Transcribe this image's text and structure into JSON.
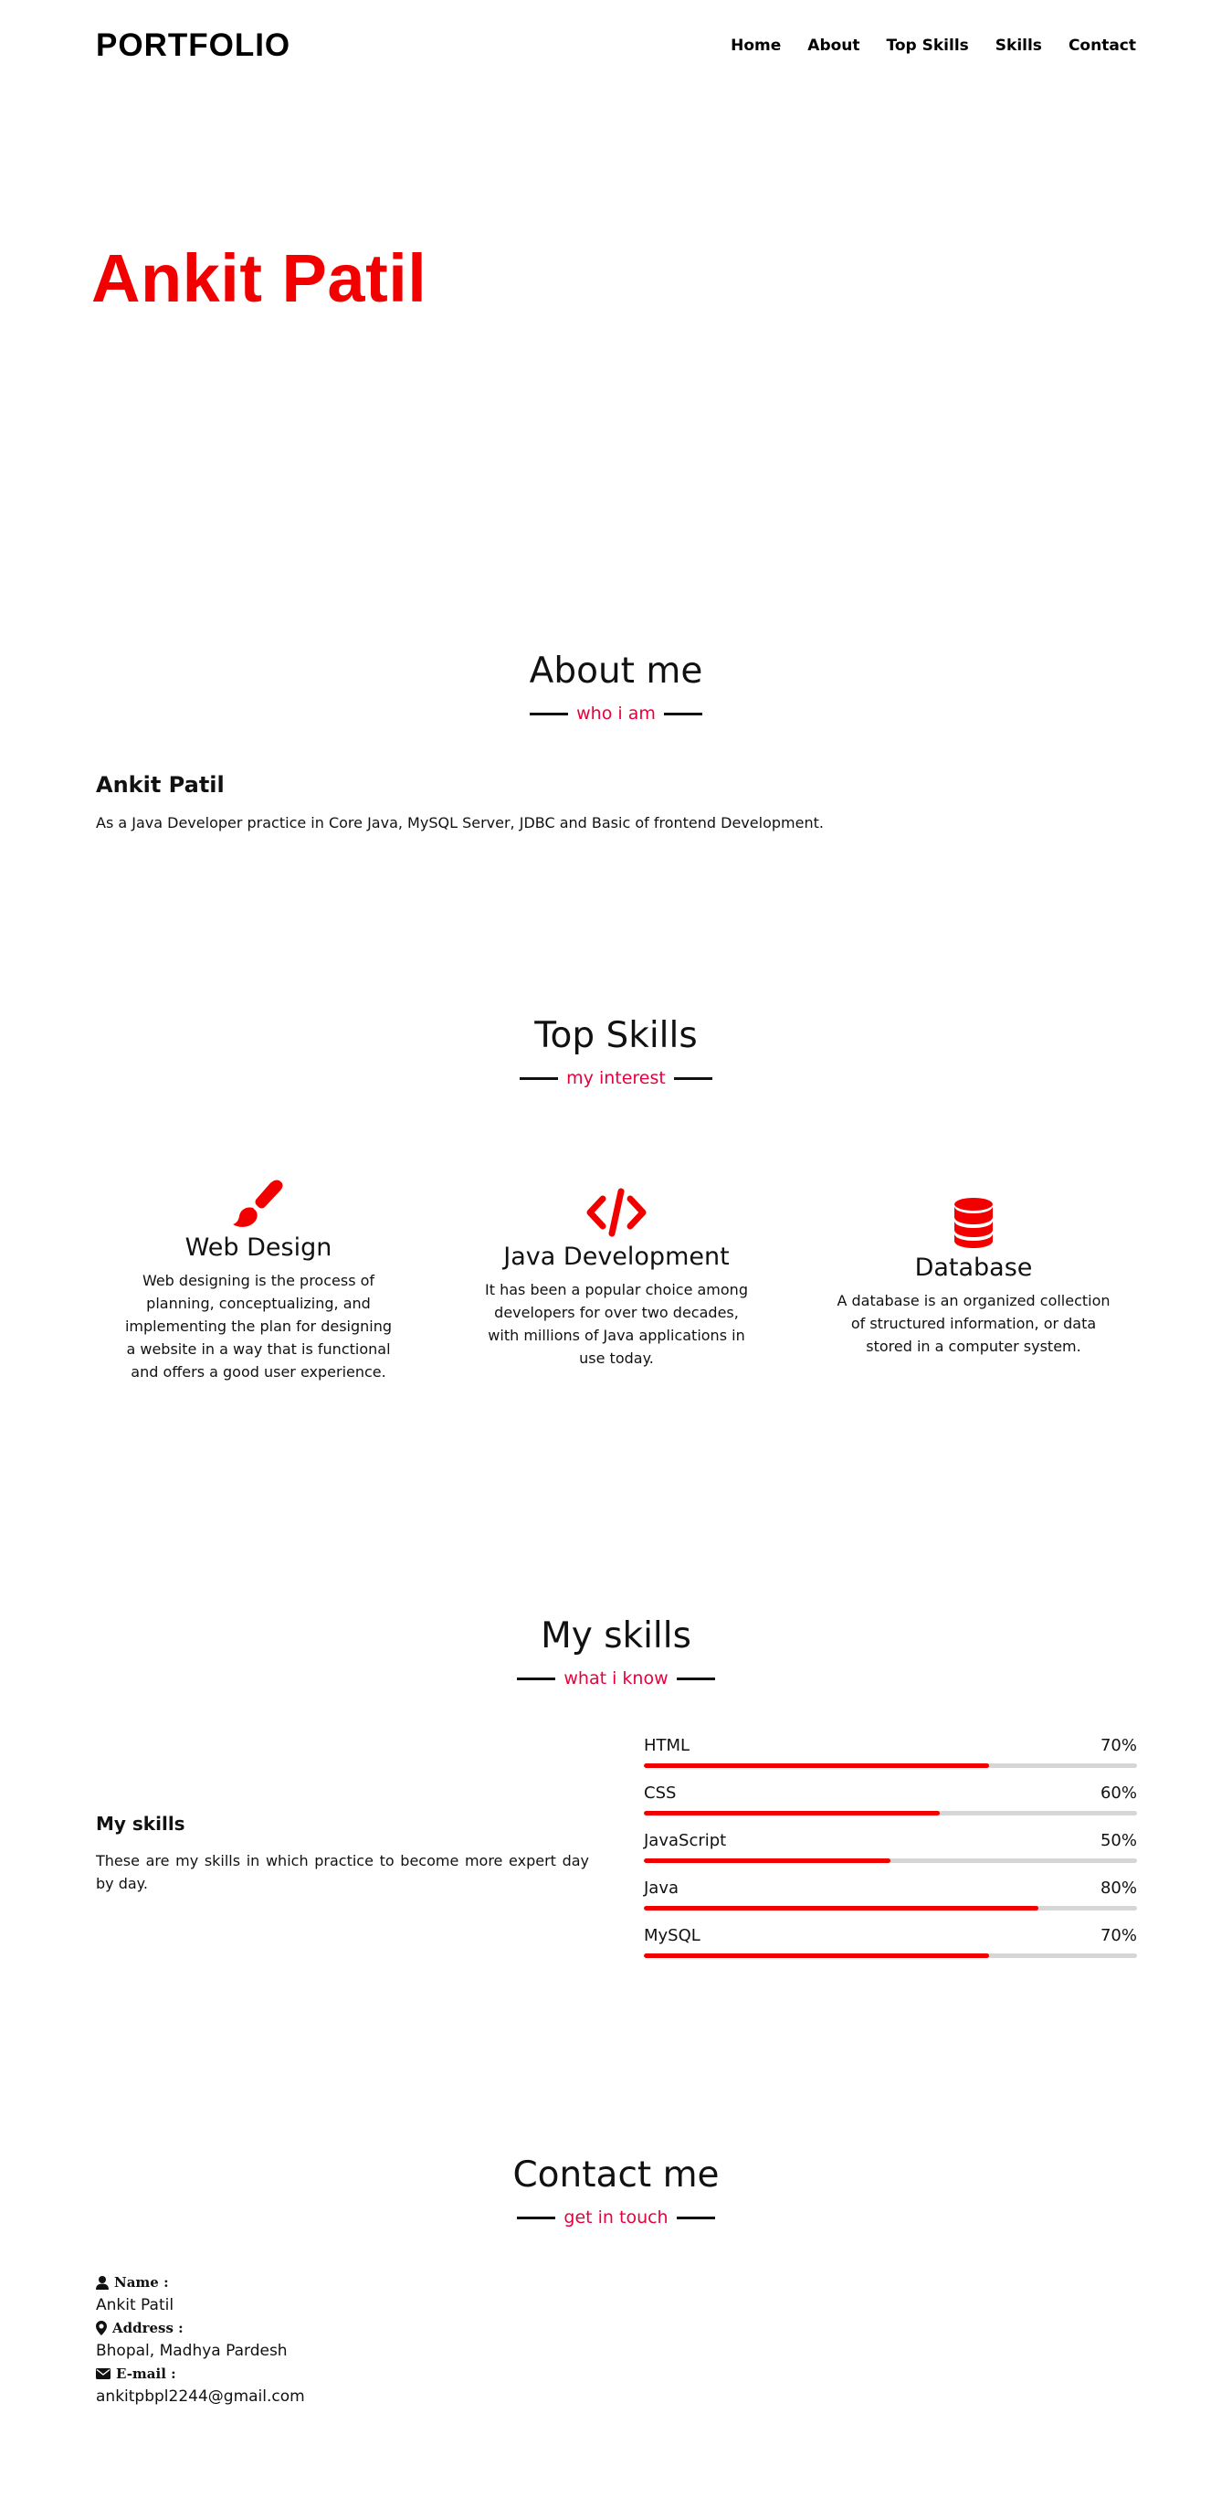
{
  "nav": {
    "logo": "PORTFOLIO",
    "items": [
      "Home",
      "About",
      "Top Skills",
      "Skills",
      "Contact"
    ]
  },
  "hero": {
    "name": "Ankit Patil"
  },
  "about": {
    "title": "About me",
    "subtitle": "who i am",
    "name": "Ankit Patil",
    "description": "As a Java Developer practice in Core Java, MySQL Server, JDBC and Basic of frontend Development."
  },
  "top_skills": {
    "title": "Top Skills",
    "subtitle": "my interest",
    "cards": [
      {
        "icon": "paint-brush-icon",
        "title": "Web Design",
        "description": "Web designing is the process of planning, conceptualizing, and implementing the plan for designing a website in a way that is functional and offers a good user experience."
      },
      {
        "icon": "code-icon",
        "title": "Java Development",
        "description": "It has been a popular choice among developers for over two decades, with millions of Java applications in use today."
      },
      {
        "icon": "database-icon",
        "title": "Database",
        "description": "A database is an organized collection of structured information, or data stored in a computer system."
      }
    ]
  },
  "my_skills": {
    "title": "My skills",
    "subtitle": "what i know",
    "heading": "My skills",
    "description": "These are my skills in which practice to become more expert day by day.",
    "bars": [
      {
        "label": "HTML",
        "percent_text": "70%",
        "value": 70
      },
      {
        "label": "CSS",
        "percent_text": "60%",
        "value": 60
      },
      {
        "label": "JavaScript",
        "percent_text": "50%",
        "value": 50
      },
      {
        "label": "Java",
        "percent_text": "80%",
        "value": 80
      },
      {
        "label": "MySQL",
        "percent_text": "70%",
        "value": 70
      }
    ]
  },
  "contact": {
    "title": "Contact me",
    "subtitle": "get in touch",
    "name_label": "Name :",
    "name_value": "Ankit Patil",
    "address_label": "Address :",
    "address_value": "Bhopal, Madhya Pardesh",
    "email_label": "E-mail :",
    "email_value": "ankitpbpl2244@gmail.com"
  },
  "colors": {
    "accent": "#f20000",
    "subtitle": "#e8003d",
    "track": "#d6d6d6",
    "text": "#111111"
  }
}
